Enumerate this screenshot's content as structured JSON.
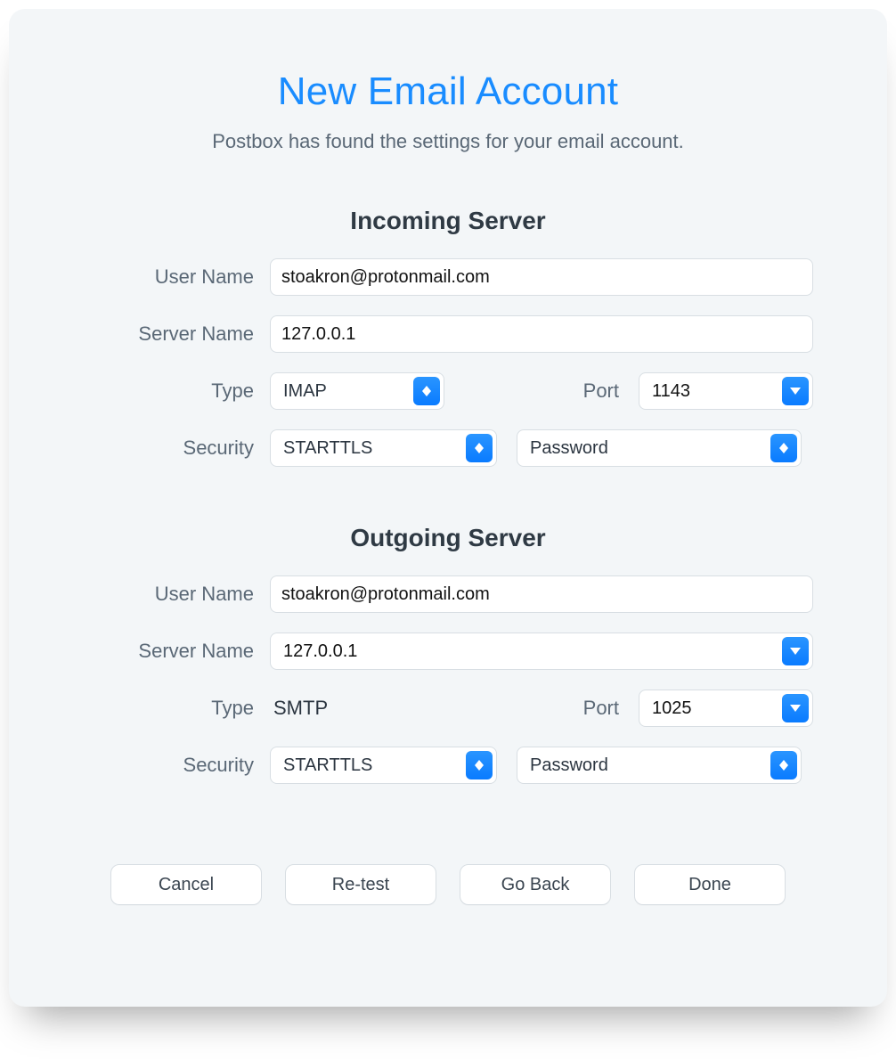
{
  "title": "New Email Account",
  "subtitle": "Postbox has found the settings for your email account.",
  "labels": {
    "username": "User Name",
    "servername": "Server Name",
    "type": "Type",
    "port": "Port",
    "security": "Security"
  },
  "incoming": {
    "heading": "Incoming Server",
    "username": "stoakron@protonmail.com",
    "server": "127.0.0.1",
    "type": "IMAP",
    "port": "1143",
    "security": "STARTTLS",
    "auth": "Password"
  },
  "outgoing": {
    "heading": "Outgoing Server",
    "username": "stoakron@protonmail.com",
    "server": "127.0.0.1",
    "type": "SMTP",
    "port": "1025",
    "security": "STARTTLS",
    "auth": "Password"
  },
  "buttons": {
    "cancel": "Cancel",
    "retest": "Re-test",
    "goback": "Go Back",
    "done": "Done"
  }
}
